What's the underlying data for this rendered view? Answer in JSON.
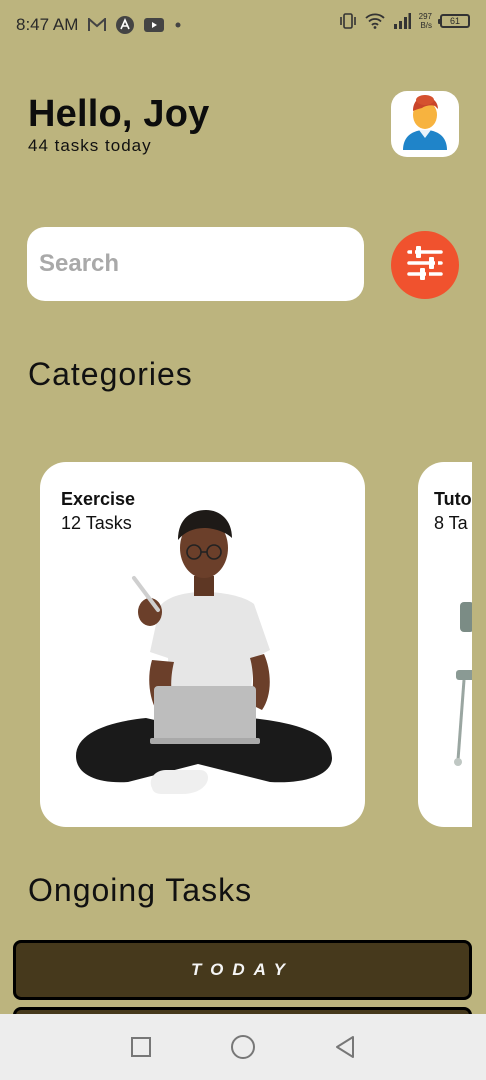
{
  "status_bar": {
    "time": "8:47 AM",
    "icons": [
      "gmail-icon",
      "app-a-icon",
      "youtube-icon",
      "dot-icon",
      "vibrate-icon",
      "wifi-icon",
      "signal-icon"
    ],
    "net_speed_value": "297",
    "net_speed_unit": "B/s",
    "battery": "61"
  },
  "header": {
    "greeting": "Hello, Joy",
    "subtitle": "44 tasks today",
    "avatar_icon": "user-avatar-icon"
  },
  "search": {
    "placeholder": "Search",
    "value": ""
  },
  "filter_button": {
    "icon": "sliders-icon",
    "color": "#f0522e"
  },
  "categories": {
    "title": "Categories",
    "items": [
      {
        "name": "Exercise",
        "count": "12 Tasks"
      },
      {
        "name": "Tuto",
        "count": "8 Ta"
      }
    ]
  },
  "ongoing": {
    "title": "Ongoing Tasks",
    "today_label": "TODAY"
  },
  "nav": {
    "icons": [
      "recents-square-icon",
      "home-circle-icon",
      "back-triangle-icon"
    ]
  },
  "colors": {
    "background": "#bcb47e",
    "accent": "#f0522e",
    "today_button": "#46391c"
  }
}
